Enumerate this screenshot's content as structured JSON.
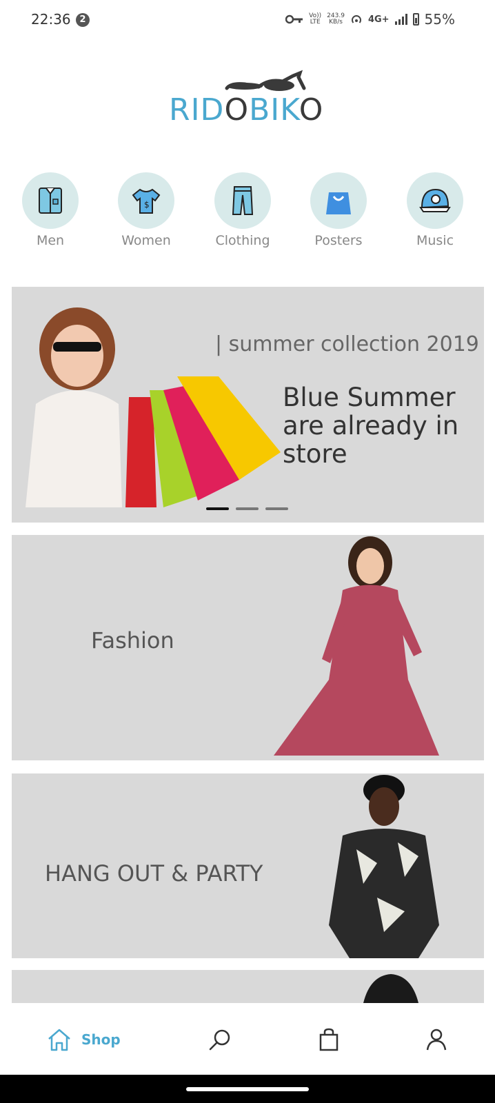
{
  "status_bar": {
    "time": "22:36",
    "notification_count": "2",
    "volte": "Vo)) LTE",
    "speed_value": "243.9",
    "speed_unit": "KB/s",
    "network": "4G+",
    "battery": "55%"
  },
  "logo": {
    "part1": "RID",
    "part2": "O",
    "part3": "BIK",
    "part4": "O"
  },
  "categories": [
    {
      "label": "Men",
      "icon": "shirt-icon"
    },
    {
      "label": "Women",
      "icon": "tshirt-icon"
    },
    {
      "label": "Clothing",
      "icon": "jeans-icon"
    },
    {
      "label": "Posters",
      "icon": "shopping-bag-icon"
    },
    {
      "label": "Music",
      "icon": "cap-icon"
    }
  ],
  "carousel": {
    "subtitle": "| summer collection 2019",
    "title": "Blue Summer are already in store",
    "slides": 3,
    "active_slide": 1
  },
  "cards": [
    {
      "label": "Fashion"
    },
    {
      "label": "HANG OUT & PARTY"
    }
  ],
  "bottom_nav": {
    "shop_label": "Shop",
    "items": [
      "home-icon",
      "search-icon",
      "bag-icon",
      "profile-icon"
    ]
  },
  "colors": {
    "accent": "#4aa8cf",
    "category_bg": "#d8eaea",
    "card_bg": "#d9d9d9"
  }
}
